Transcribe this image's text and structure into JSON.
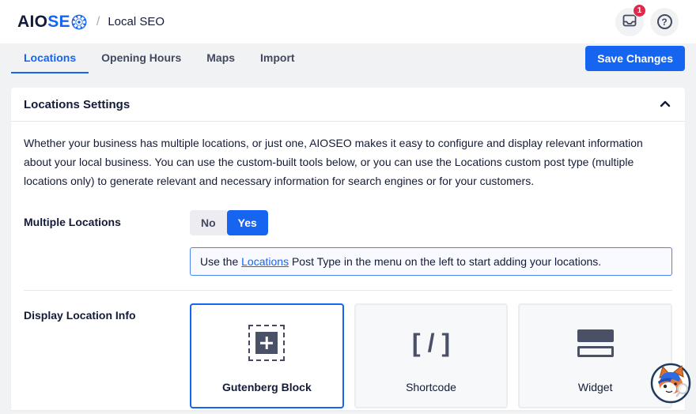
{
  "header": {
    "logo_part1": "AIO",
    "logo_part2": "SE",
    "breadcrumb_separator": "/",
    "breadcrumb": "Local SEO",
    "notification_badge": "1",
    "help_glyph": "?"
  },
  "tabs": [
    {
      "label": "Locations",
      "active": true
    },
    {
      "label": "Opening Hours",
      "active": false
    },
    {
      "label": "Maps",
      "active": false
    },
    {
      "label": "Import",
      "active": false
    }
  ],
  "toolbar": {
    "save_label": "Save Changes"
  },
  "panel": {
    "title": "Locations Settings",
    "description": "Whether your business has multiple locations, or just one, AIOSEO makes it easy to configure and display relevant information about your local business. You can use the custom-built tools below, or you can use the Locations custom post type (multiple locations only) to generate relevant and necessary information for search engines or for your customers.",
    "multiple_locations": {
      "label": "Multiple Locations",
      "options": [
        "No",
        "Yes"
      ],
      "selected": "Yes",
      "notice": {
        "pre": "Use the ",
        "link": "Locations",
        "post": " Post Type in the menu on the left to start adding your locations."
      }
    },
    "display_location_info": {
      "label": "Display Location Info",
      "shortcode_glyph": "[/]",
      "options": [
        {
          "label": "Gutenberg Block",
          "selected": true,
          "icon": "gutenberg-block-icon"
        },
        {
          "label": "Shortcode",
          "selected": false,
          "icon": "shortcode-icon"
        },
        {
          "label": "Widget",
          "selected": false,
          "icon": "widget-icon"
        }
      ]
    }
  },
  "colors": {
    "accent_blue": "#1565F1",
    "brand_navy": "#141B38",
    "badge_red": "#DF2A4A",
    "page_background": "#F1F2F4"
  }
}
